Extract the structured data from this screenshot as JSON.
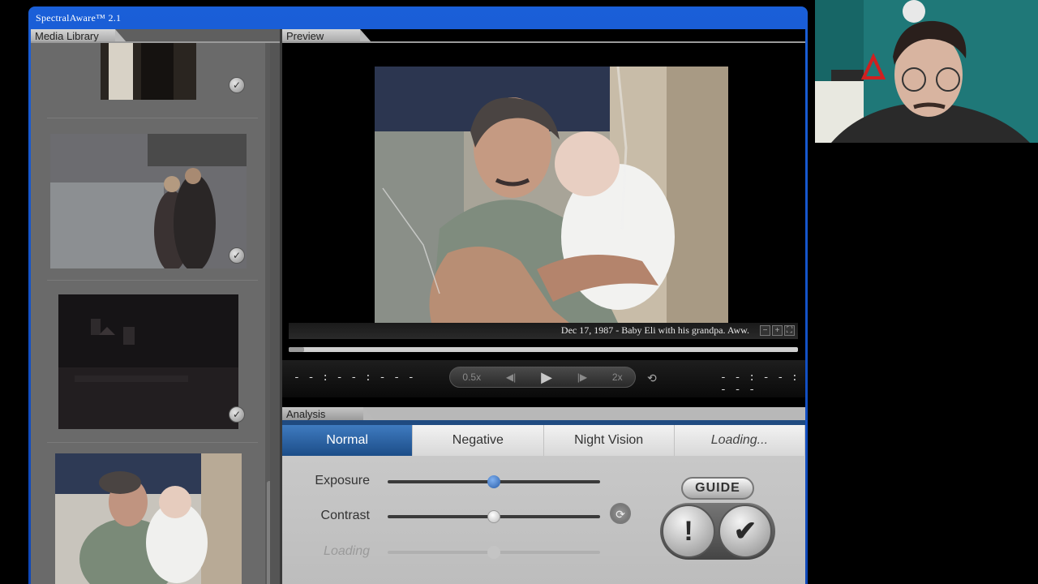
{
  "app": {
    "title": "SpectralAware™ 2.1"
  },
  "library": {
    "header": "Media Library",
    "items": [
      {
        "name": "thumb-1",
        "checked": true
      },
      {
        "name": "thumb-2",
        "checked": true
      },
      {
        "name": "thumb-3",
        "checked": true
      },
      {
        "name": "thumb-4",
        "checked": false
      }
    ]
  },
  "preview": {
    "header": "Preview",
    "caption": "Dec 17, 1987 - Baby Eli with his grandpa. Aww.",
    "caption_buttons": [
      "−",
      "+",
      "⛶"
    ],
    "progress": 0.03,
    "time_left": "- - : - - : - - -",
    "time_right": "- - : - - : - - -",
    "transport": {
      "slower": "0.5x",
      "faster": "2x"
    }
  },
  "analysis": {
    "header": "Analysis",
    "modes": [
      {
        "label": "Normal",
        "active": true
      },
      {
        "label": "Negative",
        "active": false
      },
      {
        "label": "Night Vision",
        "active": false
      },
      {
        "label": "Loading...",
        "active": false
      }
    ],
    "sliders": [
      {
        "label": "Exposure",
        "value": 0.5
      },
      {
        "label": "Contrast",
        "value": 0.5
      },
      {
        "label": "Loading",
        "value": 0.5
      }
    ],
    "guide_label": "GUIDE",
    "alert_label": "!",
    "confirm_label": "✔"
  },
  "colors": {
    "titlebar": "#1a5fd8",
    "active_mode": "#2a5ea8",
    "exposure_knob": "#2a5ea8"
  }
}
